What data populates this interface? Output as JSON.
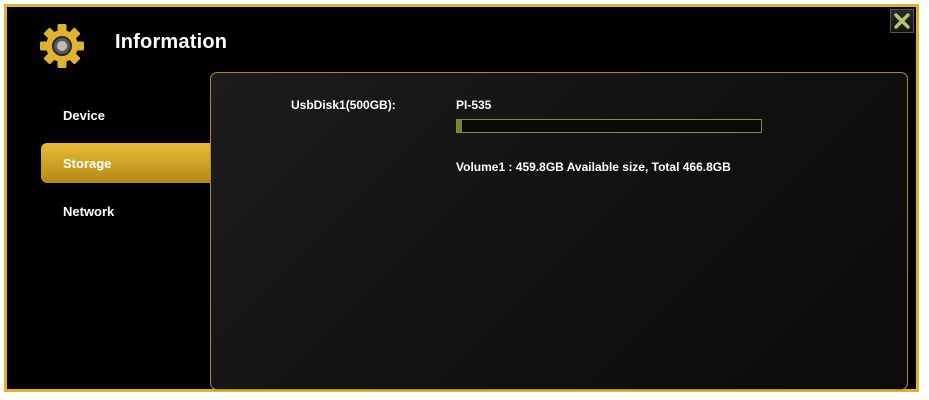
{
  "header": {
    "title": "Information",
    "icon": "gear-icon",
    "accent_color": "#e4b21c"
  },
  "close_button": {
    "icon": "close-icon"
  },
  "sidebar": {
    "items": [
      {
        "label": "Device",
        "active": false
      },
      {
        "label": "Storage",
        "active": true
      },
      {
        "label": "Network",
        "active": false
      }
    ]
  },
  "storage": {
    "disk_label": "UsbDisk1(500GB):",
    "disk_name": "PI-535",
    "used_fraction": 0.015,
    "volume_info": "Volume1 : 459.8GB Available size, Total 466.8GB"
  }
}
